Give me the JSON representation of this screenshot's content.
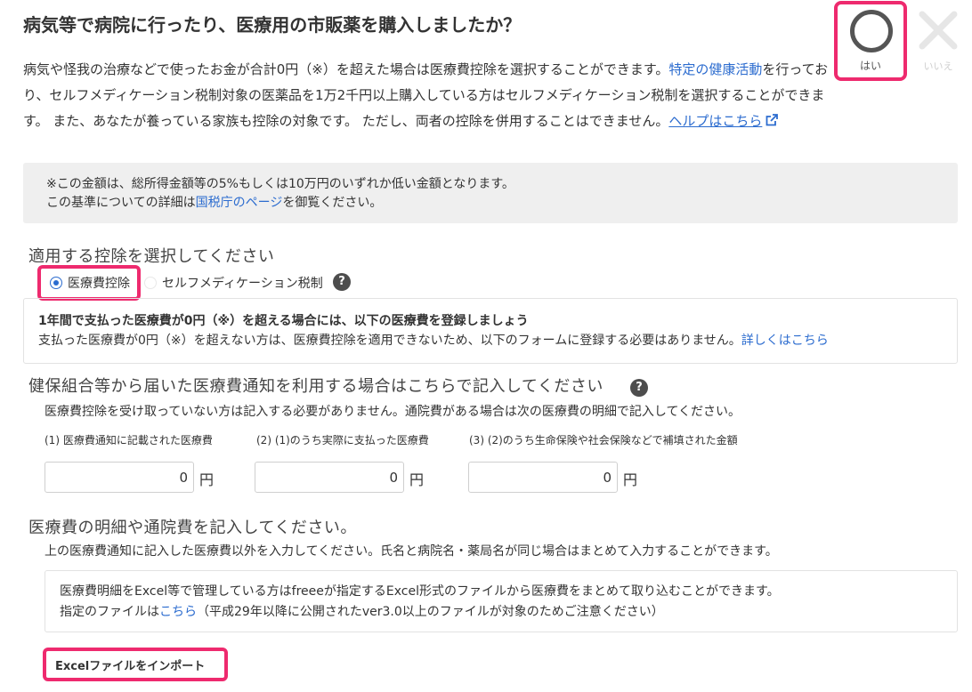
{
  "question": {
    "title": "病気等で病院に行ったり、医療用の市販薬を購入しましたか？",
    "intro_part1": "病気や怪我の治療などで使ったお金が合計0円（※）を超えた場合は医療費控除を選択することができます。",
    "intro_link": "特定の健康活動",
    "intro_part2": "を行っており、セルフメディケーション税制対象の医薬品を1万2千円以上購入している方はセルフメディケーション税制を選択することができます。 また、あなたが養っている家族も控除の対象です。 ただし、両者の控除を併用することはできません。",
    "help_link": "ヘルプはこちら"
  },
  "answer": {
    "yes_label": "はい",
    "no_label": "いいえ"
  },
  "note": {
    "line1": "※この金額は、総所得金額等の5%もしくは10万円のいずれか低い金額となります。",
    "line2_pre": "この基準についての詳細は",
    "line2_link": "国税庁のページ",
    "line2_post": "を御覧ください。"
  },
  "deduction_select": {
    "title": "適用する控除を選択してください",
    "options": [
      {
        "label": "医療費控除",
        "selected": true
      },
      {
        "label": "セルフメディケーション税制",
        "selected": false
      }
    ]
  },
  "info": {
    "bold": "1年間で支払った医療費が0円（※）を超える場合には、以下の医療費を登録しましょう",
    "text": "支払った医療費が0円（※）を超えない方は、医療費控除を適用できないため、以下のフォームに登録する必要はありません。",
    "link": "詳しくはこちら"
  },
  "kenpo": {
    "title": "健保組合等から届いた医療費通知を利用する場合はこちらで記入してください",
    "desc": "医療費控除を受け取っていない方は記入する必要がありません。通院費がある場合は次の医療費の明細で記入してください。",
    "fields": [
      {
        "label": "(1) 医療費通知に記載された医療費",
        "value": "0",
        "unit": "円"
      },
      {
        "label": "(2) (1)のうち実際に支払った医療費",
        "value": "0",
        "unit": "円"
      },
      {
        "label": "(3) (2)のうち生命保険や社会保険などで補填された金額",
        "value": "0",
        "unit": "円"
      }
    ]
  },
  "details": {
    "title": "医療費の明細や通院費を記入してください。",
    "desc": "上の医療費通知に記入した医療費以外を入力してください。氏名と病院名・薬局名が同じ場合はまとめて入力することができます。",
    "excel_line1": "医療費明細をExcel等で管理している方はfreeeが指定するExcel形式のファイルから医療費をまとめて取り込むことができます。",
    "excel_line2_pre": "指定のファイルは",
    "excel_line2_link": "こちら",
    "excel_line2_post": "（平成29年以降に公開されたver3.0以上のファイルが対象のためご注意ください）",
    "import_button": "Excelファイルをインポート"
  },
  "colors": {
    "highlight": "#ee2a6e",
    "link": "#2c6ccf"
  }
}
